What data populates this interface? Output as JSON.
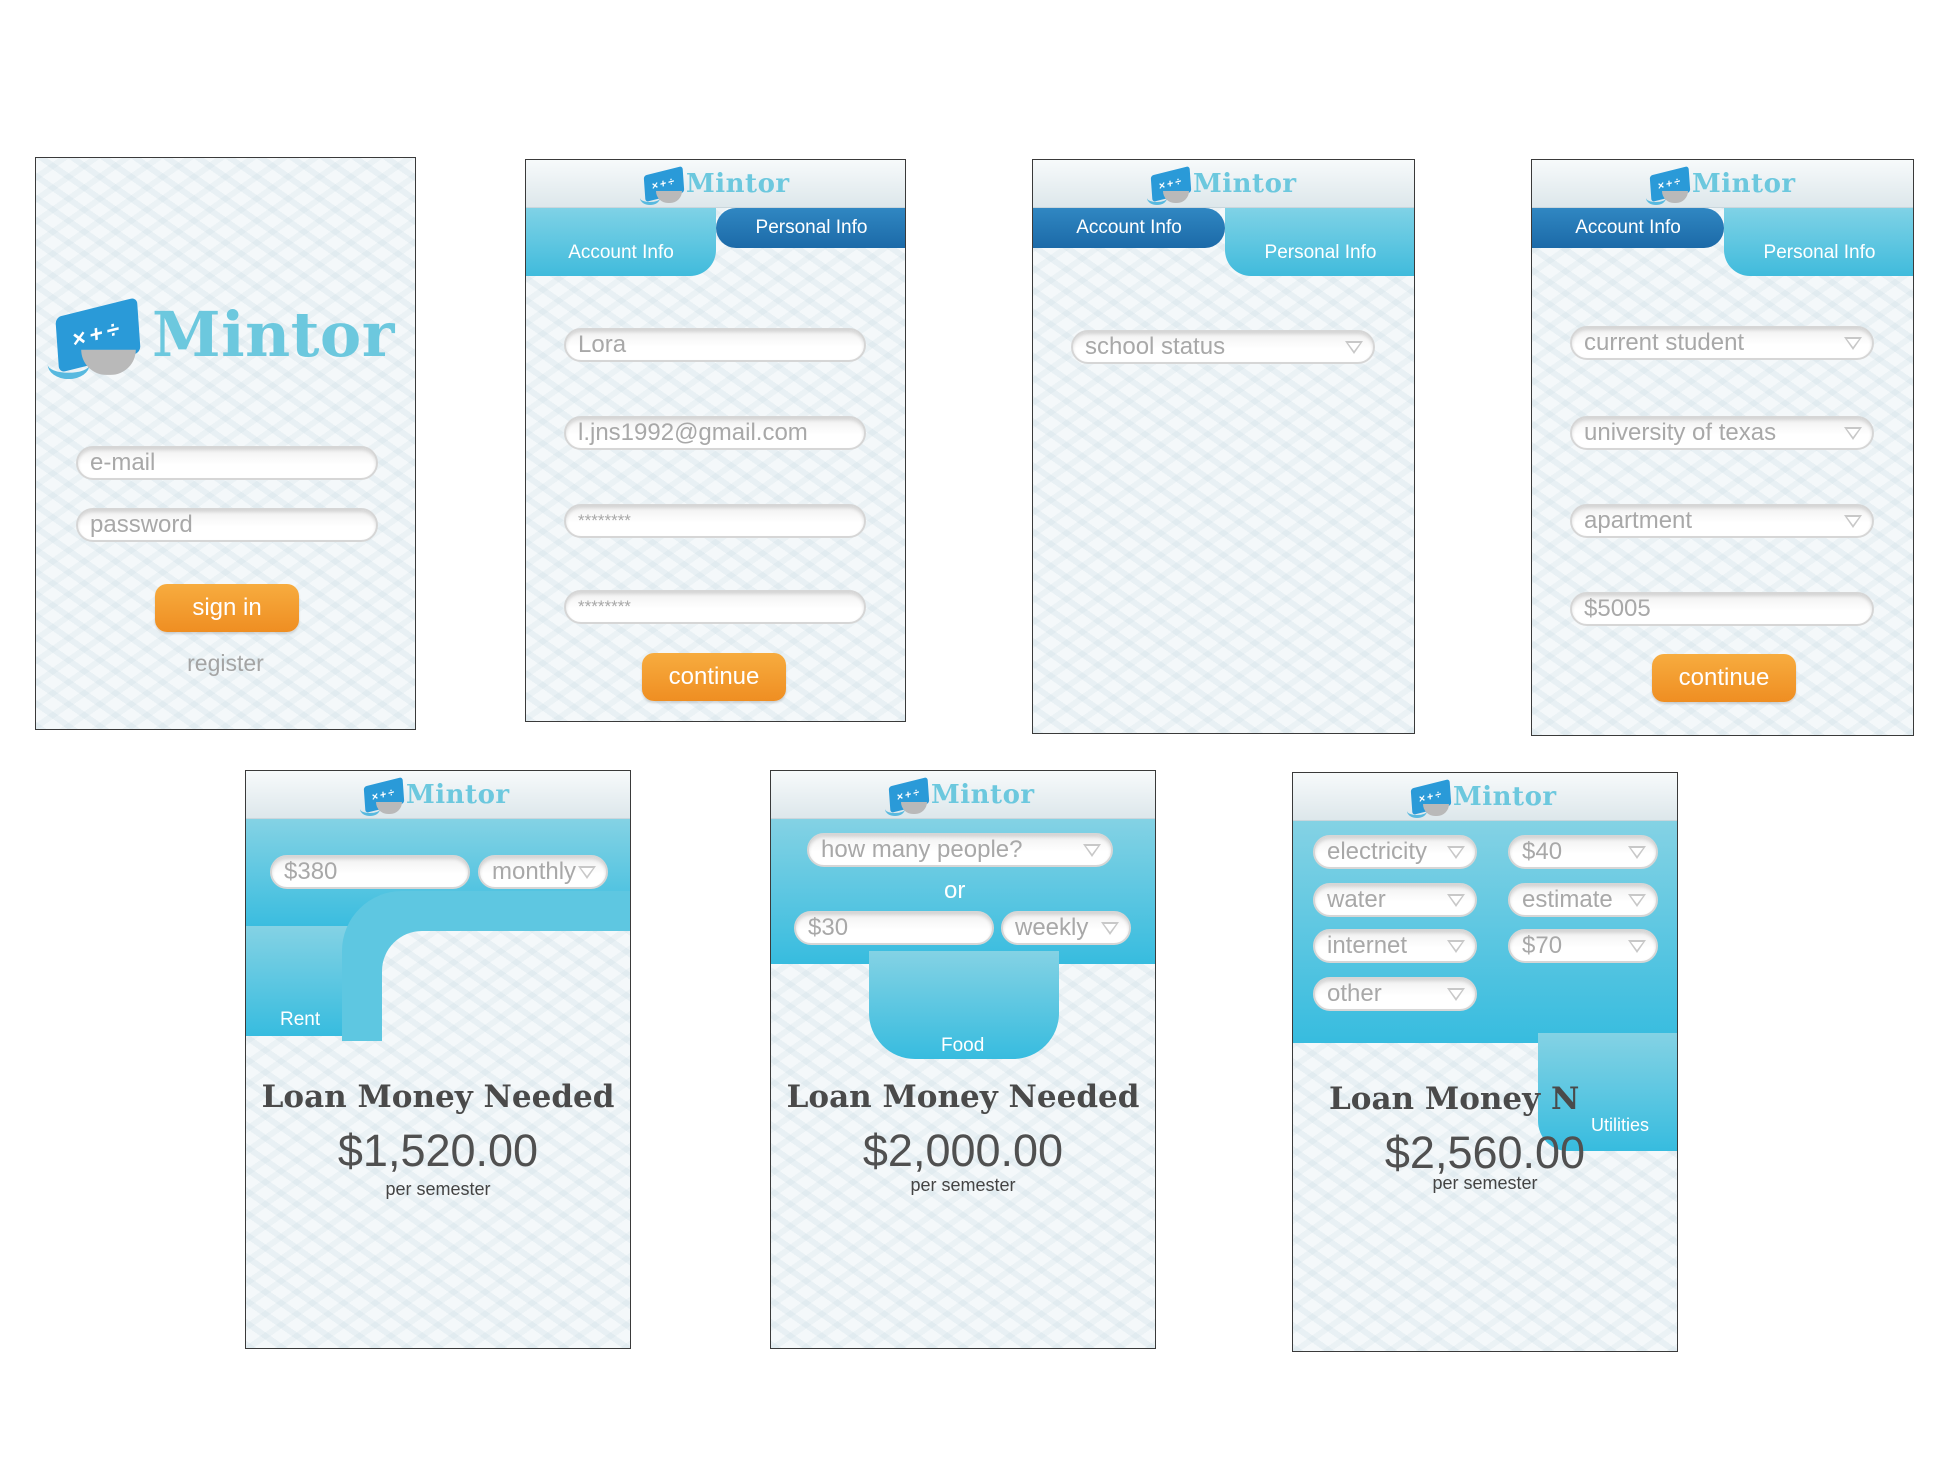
{
  "brand": {
    "name": "Mintor",
    "accent": "#6cc8de",
    "button_color": "#f39a2c",
    "tab_dark": "#1f6fae"
  },
  "login": {
    "email_placeholder": "e-mail",
    "password_placeholder": "password",
    "signin_label": "sign in",
    "register_label": "register"
  },
  "tabs": {
    "account": "Account Info",
    "personal": "Personal Info"
  },
  "account_screen": {
    "name_value": "Lora",
    "email_value": "l.jns1992@gmail.com",
    "password_value": "********",
    "confirm_value": "********",
    "continue_label": "continue"
  },
  "school_screen": {
    "status_placeholder": "school status"
  },
  "personal_screen": {
    "status_value": "current student",
    "school_value": "university of texas",
    "housing_value": "apartment",
    "amount_value": "$5005",
    "continue_label": "continue"
  },
  "rent_screen": {
    "amount_value": "$380",
    "frequency_value": "monthly",
    "section_label": "Rent",
    "loan_title": "Loan Money Needed",
    "loan_amount": "$1,520.00",
    "loan_period": "per semester"
  },
  "food_screen": {
    "people_placeholder": "how many people?",
    "or_label": "or",
    "amount_value": "$30",
    "frequency_value": "weekly",
    "section_label": "Food",
    "loan_title": "Loan Money Needed",
    "loan_amount": "$2,000.00",
    "loan_period": "per semester"
  },
  "utilities_screen": {
    "items": [
      {
        "label": "electricity",
        "value": "$40"
      },
      {
        "label": "water",
        "value": "estimate"
      },
      {
        "label": "internet",
        "value": "$70"
      },
      {
        "label": "other"
      }
    ],
    "section_label": "Utilities",
    "loan_title": "Loan Money N",
    "loan_amount": "$2,560.00",
    "loan_period": "per semester"
  }
}
